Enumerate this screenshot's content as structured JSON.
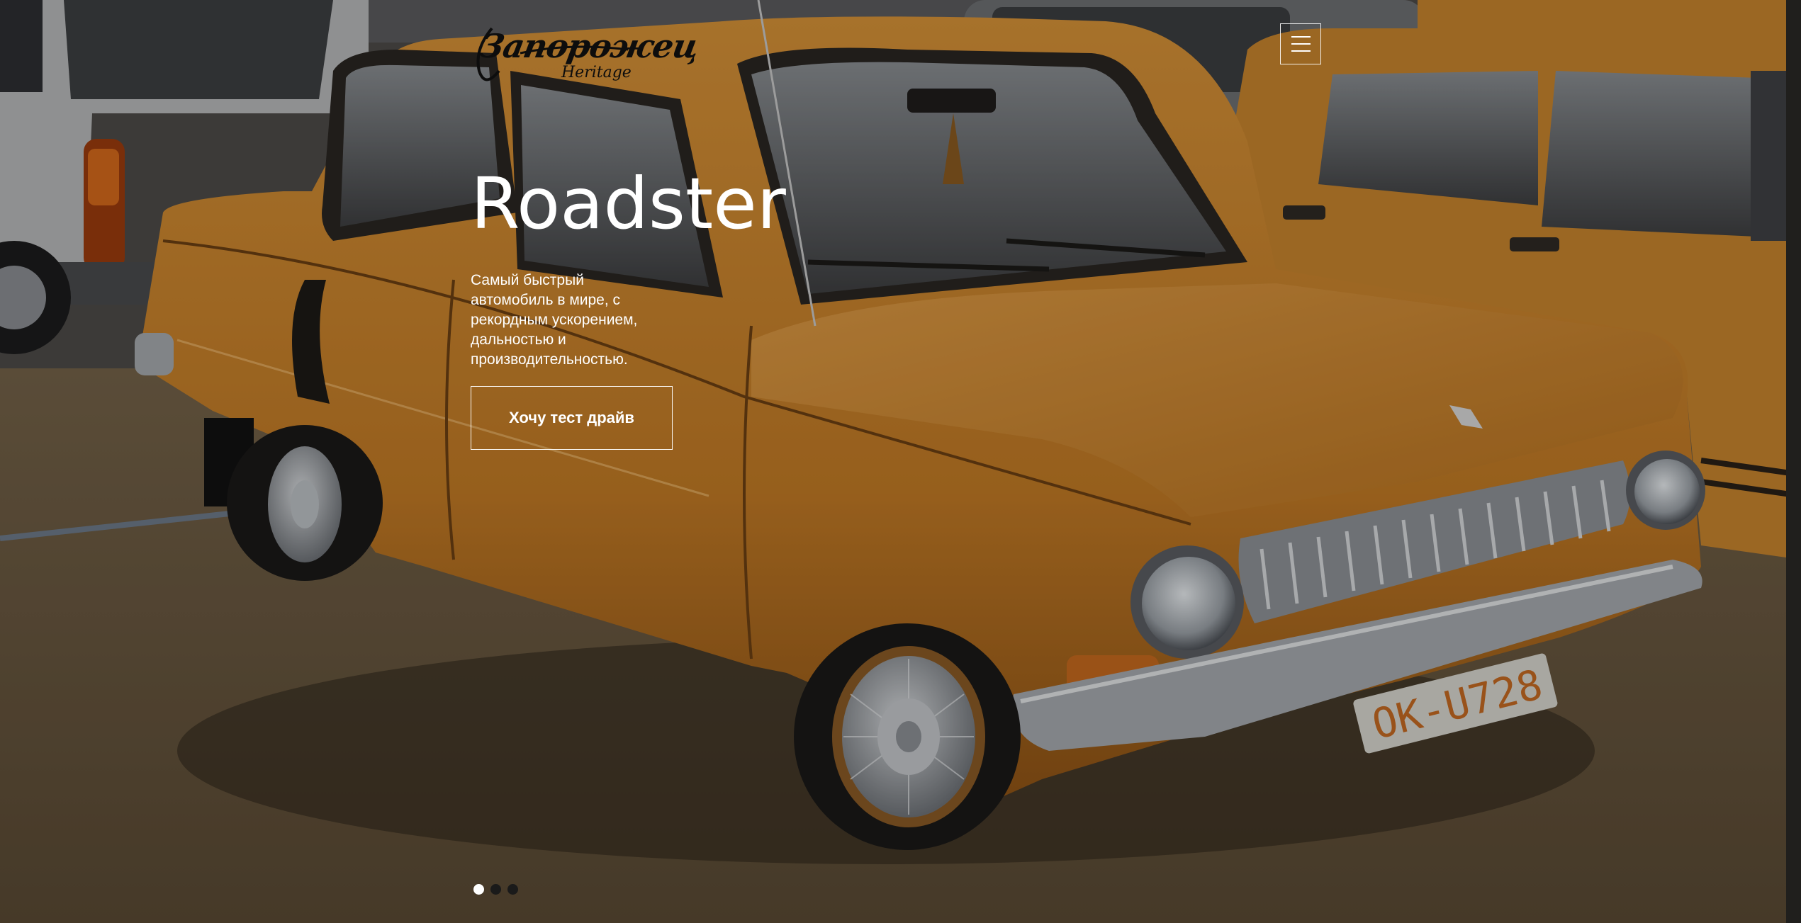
{
  "logo": {
    "main_text": "Запорожец",
    "sub_text": "Heritage"
  },
  "menu": {
    "icon": "hamburger-menu-icon"
  },
  "hero": {
    "title": "Roadster",
    "description": "Самый быстрый автомобиль в мире, с рекордным ускорением, дальностью и производительностью.",
    "cta_label": "Хочу тест драйв",
    "license_plate": "OK-U728"
  },
  "slider": {
    "slide_count": 3,
    "active_index": 0
  },
  "colors": {
    "car_orange": "#c7842e",
    "grass": "#6b5a3f",
    "overlay": "rgba(0,0,0,0.22)",
    "text": "#ffffff"
  }
}
